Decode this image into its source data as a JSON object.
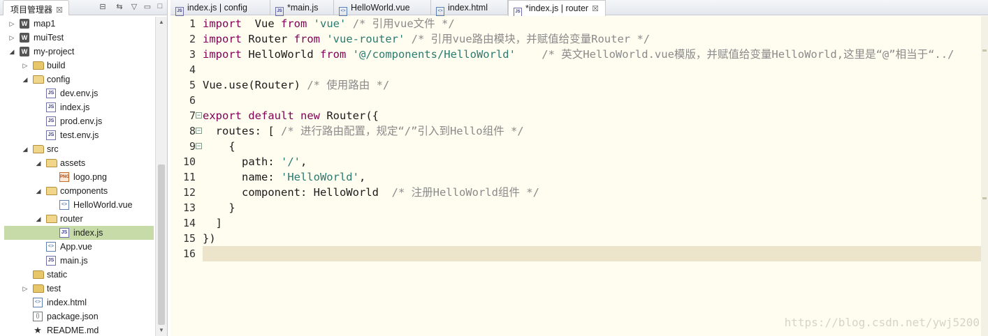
{
  "explorer": {
    "title": "项目管理器",
    "close_glyph": "☒",
    "tools": {
      "collapse": "⊟",
      "link": "⇆",
      "menu": "▽",
      "minimize": "▭",
      "maximize": "□"
    },
    "items": [
      {
        "label": "map1",
        "icon": "project-icon",
        "level": 0,
        "twisty": "▷"
      },
      {
        "label": "muiTest",
        "icon": "project-icon",
        "level": 0,
        "twisty": "▷"
      },
      {
        "label": "my-project",
        "icon": "project-icon",
        "level": 0,
        "twisty": "◢"
      },
      {
        "label": "build",
        "icon": "folder-icon",
        "level": 1,
        "twisty": "▷"
      },
      {
        "label": "config",
        "icon": "folder-open-icon",
        "level": 1,
        "twisty": "◢"
      },
      {
        "label": "dev.env.js",
        "icon": "js-file-icon",
        "level": 2,
        "twisty": ""
      },
      {
        "label": "index.js",
        "icon": "js-file-icon",
        "level": 2,
        "twisty": ""
      },
      {
        "label": "prod.env.js",
        "icon": "js-file-icon",
        "level": 2,
        "twisty": ""
      },
      {
        "label": "test.env.js",
        "icon": "js-file-icon",
        "level": 2,
        "twisty": ""
      },
      {
        "label": "src",
        "icon": "folder-open-icon",
        "level": 1,
        "twisty": "◢"
      },
      {
        "label": "assets",
        "icon": "folder-open-icon",
        "level": 2,
        "twisty": "◢"
      },
      {
        "label": "logo.png",
        "icon": "png-file-icon",
        "level": 3,
        "twisty": ""
      },
      {
        "label": "components",
        "icon": "folder-open-icon",
        "level": 2,
        "twisty": "◢"
      },
      {
        "label": "HelloWorld.vue",
        "icon": "vue-file-icon",
        "level": 3,
        "twisty": ""
      },
      {
        "label": "router",
        "icon": "folder-open-icon",
        "level": 2,
        "twisty": "◢"
      },
      {
        "label": "index.js",
        "icon": "js-file-icon",
        "level": 3,
        "twisty": "",
        "selected": true
      },
      {
        "label": "App.vue",
        "icon": "vue-file-icon",
        "level": 2,
        "twisty": ""
      },
      {
        "label": "main.js",
        "icon": "js-file-icon",
        "level": 2,
        "twisty": ""
      },
      {
        "label": "static",
        "icon": "folder-icon",
        "level": 1,
        "twisty": ""
      },
      {
        "label": "test",
        "icon": "folder-icon",
        "level": 1,
        "twisty": "▷"
      },
      {
        "label": "index.html",
        "icon": "html-file-icon",
        "level": 1,
        "twisty": ""
      },
      {
        "label": "package.json",
        "icon": "json-file-icon",
        "level": 1,
        "twisty": ""
      },
      {
        "label": "README.md",
        "icon": "star-icon",
        "level": 1,
        "twisty": ""
      }
    ]
  },
  "editor": {
    "tabs": [
      {
        "label": "index.js | config",
        "icon": "js-file-icon",
        "active": false,
        "close": ""
      },
      {
        "label": "*main.js",
        "icon": "js-file-icon",
        "active": false,
        "close": ""
      },
      {
        "label": "HelloWorld.vue",
        "icon": "vue-file-icon",
        "active": false,
        "close": ""
      },
      {
        "label": "index.html",
        "icon": "html-file-icon",
        "active": false,
        "close": ""
      },
      {
        "label": "*index.js | router",
        "icon": "js-file-icon",
        "active": true,
        "close": "☒"
      }
    ],
    "current_line": 16,
    "lines": [
      {
        "n": "1",
        "fold": "",
        "tokens": [
          [
            "kw",
            "import"
          ],
          [
            "",
            "  Vue "
          ],
          [
            "kw",
            "from"
          ],
          [
            "",
            " "
          ],
          [
            "str",
            "'vue'"
          ],
          [
            "",
            " "
          ],
          [
            "cm",
            "/* 引用vue文件 */"
          ]
        ]
      },
      {
        "n": "2",
        "fold": "",
        "tokens": [
          [
            "kw",
            "import"
          ],
          [
            "",
            " Router "
          ],
          [
            "kw",
            "from"
          ],
          [
            "",
            " "
          ],
          [
            "str",
            "'vue-router'"
          ],
          [
            "",
            " "
          ],
          [
            "cm",
            "/* 引用vue路由模块，并赋值给变量Router */"
          ]
        ]
      },
      {
        "n": "3",
        "fold": "",
        "tokens": [
          [
            "kw",
            "import"
          ],
          [
            "",
            " HelloWorld "
          ],
          [
            "kw",
            "from"
          ],
          [
            "",
            " "
          ],
          [
            "str",
            "'@/components/HelloWorld'"
          ],
          [
            "",
            "    "
          ],
          [
            "cm",
            "/* 英文HelloWorld.vue模版，并赋值给变量HelloWorld,这里是“@”相当于“../"
          ]
        ]
      },
      {
        "n": "4",
        "fold": "",
        "tokens": []
      },
      {
        "n": "5",
        "fold": "",
        "tokens": [
          [
            "",
            "Vue.use(Router) "
          ],
          [
            "cm",
            "/* 使用路由 */"
          ]
        ]
      },
      {
        "n": "6",
        "fold": "",
        "tokens": []
      },
      {
        "n": "7",
        "fold": "−",
        "tokens": [
          [
            "kw",
            "export"
          ],
          [
            "",
            " "
          ],
          [
            "kw",
            "default"
          ],
          [
            "",
            " "
          ],
          [
            "kw",
            "new"
          ],
          [
            "",
            " Router({"
          ]
        ]
      },
      {
        "n": "8",
        "fold": "−",
        "tokens": [
          [
            "",
            "  routes: [ "
          ],
          [
            "cm",
            "/* 进行路由配置，规定“/”引入到Hello组件 */"
          ]
        ]
      },
      {
        "n": "9",
        "fold": "−",
        "tokens": [
          [
            "",
            "    {"
          ]
        ]
      },
      {
        "n": "10",
        "fold": "",
        "tokens": [
          [
            "",
            "      path: "
          ],
          [
            "str",
            "'/'"
          ],
          [
            "",
            ","
          ]
        ]
      },
      {
        "n": "11",
        "fold": "",
        "tokens": [
          [
            "",
            "      name: "
          ],
          [
            "str",
            "'HelloWorld'"
          ],
          [
            "",
            ","
          ]
        ]
      },
      {
        "n": "12",
        "fold": "",
        "tokens": [
          [
            "",
            "      component: HelloWorld  "
          ],
          [
            "cm",
            "/* 注册HelloWorld组件 */"
          ]
        ]
      },
      {
        "n": "13",
        "fold": "",
        "tokens": [
          [
            "",
            "    }"
          ]
        ]
      },
      {
        "n": "14",
        "fold": "",
        "tokens": [
          [
            "",
            "  ]"
          ]
        ]
      },
      {
        "n": "15",
        "fold": "",
        "tokens": [
          [
            "",
            "})"
          ]
        ]
      },
      {
        "n": "16",
        "fold": "",
        "tokens": []
      }
    ],
    "watermark": "https://blog.csdn.net/ywj5200"
  },
  "colors": {
    "selection": "#c6dba8",
    "editor_bg": "#fffdf0",
    "current_line": "#ece4cb",
    "keyword": "#7f0055",
    "string": "#2a7a6f",
    "comment": "#8a8a8a"
  }
}
